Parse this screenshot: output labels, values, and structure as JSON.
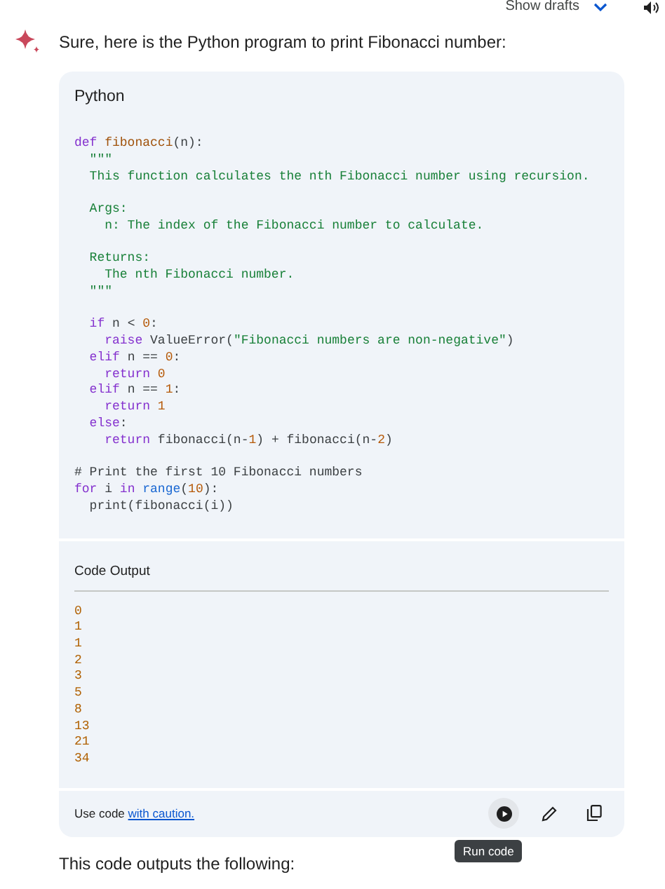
{
  "top_bar": {
    "drafts_label": "Show drafts"
  },
  "response": {
    "intro": "Sure, here is the Python program to print Fibonacci number:",
    "code_block": {
      "language": "Python",
      "lines": [
        {
          "gap_before": false,
          "tokens": [
            {
              "kind": "keyword",
              "text": "def "
            },
            {
              "kind": "function",
              "text": "fibonacci"
            },
            {
              "kind": "plain",
              "text": "(n):"
            }
          ]
        },
        {
          "gap_before": false,
          "tokens": [
            {
              "kind": "string",
              "text": "  \"\"\""
            }
          ]
        },
        {
          "gap_before": false,
          "tokens": [
            {
              "kind": "string",
              "text": "  This function calculates the nth Fibonacci number using recursion."
            }
          ]
        },
        {
          "gap_before": true,
          "tokens": [
            {
              "kind": "string",
              "text": "  Args:"
            }
          ]
        },
        {
          "gap_before": false,
          "tokens": [
            {
              "kind": "string",
              "text": "    n: The index of the Fibonacci number to calculate."
            }
          ]
        },
        {
          "gap_before": true,
          "tokens": [
            {
              "kind": "string",
              "text": "  Returns:"
            }
          ]
        },
        {
          "gap_before": false,
          "tokens": [
            {
              "kind": "string",
              "text": "    The nth Fibonacci number."
            }
          ]
        },
        {
          "gap_before": false,
          "tokens": [
            {
              "kind": "string",
              "text": "  \"\"\""
            }
          ]
        },
        {
          "gap_before": true,
          "tokens": [
            {
              "kind": "keyword",
              "text": "  if "
            },
            {
              "kind": "plain",
              "text": "n < "
            },
            {
              "kind": "number",
              "text": "0"
            },
            {
              "kind": "plain",
              "text": ":"
            }
          ]
        },
        {
          "gap_before": false,
          "tokens": [
            {
              "kind": "keyword",
              "text": "    raise "
            },
            {
              "kind": "plain",
              "text": "ValueError("
            },
            {
              "kind": "string",
              "text": "\"Fibonacci numbers are non-negative\""
            },
            {
              "kind": "plain",
              "text": ")"
            }
          ]
        },
        {
          "gap_before": false,
          "tokens": [
            {
              "kind": "keyword",
              "text": "  elif "
            },
            {
              "kind": "plain",
              "text": "n == "
            },
            {
              "kind": "number",
              "text": "0"
            },
            {
              "kind": "plain",
              "text": ":"
            }
          ]
        },
        {
          "gap_before": false,
          "tokens": [
            {
              "kind": "keyword",
              "text": "    return "
            },
            {
              "kind": "number",
              "text": "0"
            }
          ]
        },
        {
          "gap_before": false,
          "tokens": [
            {
              "kind": "keyword",
              "text": "  elif "
            },
            {
              "kind": "plain",
              "text": "n == "
            },
            {
              "kind": "number",
              "text": "1"
            },
            {
              "kind": "plain",
              "text": ":"
            }
          ]
        },
        {
          "gap_before": false,
          "tokens": [
            {
              "kind": "keyword",
              "text": "    return "
            },
            {
              "kind": "number",
              "text": "1"
            }
          ]
        },
        {
          "gap_before": false,
          "tokens": [
            {
              "kind": "keyword",
              "text": "  else"
            },
            {
              "kind": "plain",
              "text": ":"
            }
          ]
        },
        {
          "gap_before": false,
          "tokens": [
            {
              "kind": "keyword",
              "text": "    return "
            },
            {
              "kind": "plain",
              "text": "fibonacci(n-"
            },
            {
              "kind": "number",
              "text": "1"
            },
            {
              "kind": "plain",
              "text": ") + fibonacci(n-"
            },
            {
              "kind": "number",
              "text": "2"
            },
            {
              "kind": "plain",
              "text": ")"
            }
          ]
        },
        {
          "gap_before": true,
          "tokens": [
            {
              "kind": "comment",
              "text": "# Print the first 10 Fibonacci numbers"
            }
          ]
        },
        {
          "gap_before": false,
          "tokens": [
            {
              "kind": "keyword",
              "text": "for "
            },
            {
              "kind": "plain",
              "text": "i "
            },
            {
              "kind": "keyword",
              "text": "in "
            },
            {
              "kind": "builtin",
              "text": "range"
            },
            {
              "kind": "plain",
              "text": "("
            },
            {
              "kind": "number",
              "text": "10"
            },
            {
              "kind": "plain",
              "text": "):"
            }
          ]
        },
        {
          "gap_before": false,
          "tokens": [
            {
              "kind": "plain",
              "text": "  print(fibonacci(i))"
            }
          ]
        }
      ]
    },
    "code_output": {
      "title": "Code Output",
      "lines": [
        "0",
        "1",
        "1",
        "2",
        "3",
        "5",
        "8",
        "13",
        "21",
        "34"
      ]
    },
    "footer": {
      "caution_prefix": "Use code ",
      "caution_link": "with caution.",
      "tooltip": "Run code"
    },
    "after_text": "This code outputs the following:"
  }
}
